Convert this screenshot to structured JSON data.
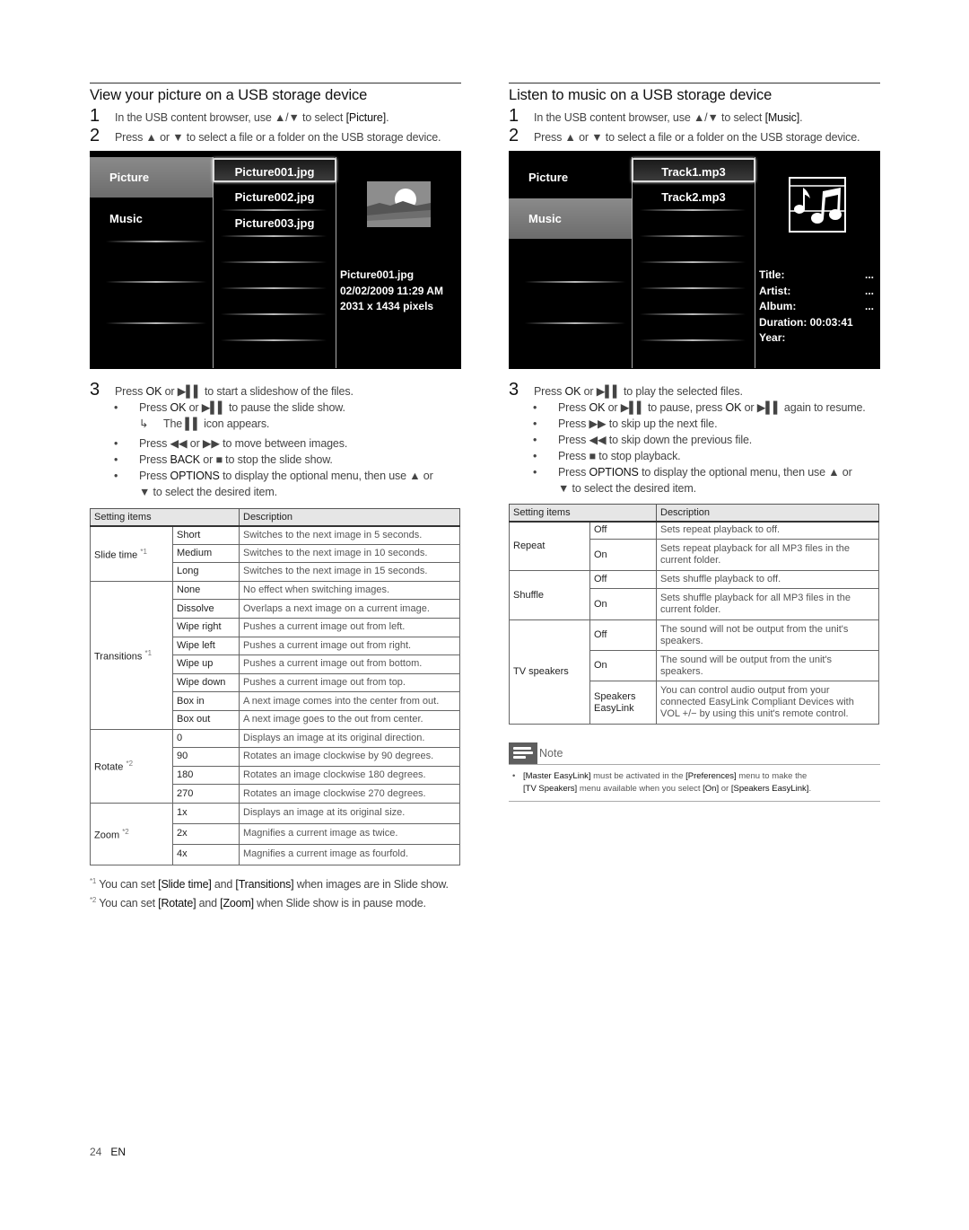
{
  "left": {
    "title": "View your picture on a USB storage device",
    "steps": [
      {
        "num": "1",
        "text_pre": "In the USB content browser, use ▲/▼ to select ",
        "bold": "[Picture]",
        "text_post": "."
      },
      {
        "num": "2",
        "text": "Press ▲ or ▼ to select a file or a folder on the USB storage device."
      }
    ],
    "screen": {
      "categories": [
        "Picture",
        "Music"
      ],
      "selected_category": "Picture",
      "files": [
        "Picture001.jpg",
        "Picture002.jpg",
        "Picture003.jpg"
      ],
      "selected_file": "Picture001.jpg",
      "info": [
        "Picture001.jpg",
        "02/02/2009 11:29 AM",
        "2031 x 1434 pixels"
      ]
    },
    "step3": {
      "num": "3",
      "pre": "Press ",
      "ok": "OK",
      "mid": " or ▶▌▌ to start a slideshow of the files."
    },
    "bullets": [
      {
        "pre": "Press ",
        "b": "OK",
        "post": " or ▶▌▌ to pause the slide show."
      },
      {
        "pre": "Press ◀◀ or ▶▶ to move between images.",
        "b": "",
        "post": ""
      },
      {
        "pre": "Press ",
        "b": "BACK",
        "post": " or ■ to stop the slide show."
      },
      {
        "pre": "Press ",
        "b": "OPTIONS",
        "post": " to display the optional menu, then use ▲ or"
      }
    ],
    "bullet_sub": "The ▌▌ icon appears.",
    "bullet_cont": "▼ to select the desired item.",
    "table": {
      "headers": [
        "Setting items",
        "Description"
      ],
      "groups": [
        {
          "item": "Slide time",
          "mark": "*1",
          "rows": [
            [
              "Short",
              "Switches to the next image in 5 seconds."
            ],
            [
              "Medium",
              "Switches to the next image in 10 seconds."
            ],
            [
              "Long",
              "Switches to the next image in 15 seconds."
            ]
          ]
        },
        {
          "item": "Transitions",
          "mark": "*1",
          "rows": [
            [
              "None",
              "No effect when switching images."
            ],
            [
              "Dissolve",
              "Overlaps a next image on a current image."
            ],
            [
              "Wipe right",
              "Pushes a current image out from left."
            ],
            [
              "Wipe left",
              "Pushes a current image out from right."
            ],
            [
              "Wipe up",
              "Pushes a current image out from bottom."
            ],
            [
              "Wipe down",
              "Pushes a current image out from top."
            ],
            [
              "Box in",
              "A next image comes into the center from out."
            ],
            [
              "Box out",
              "A next image goes to the out from center."
            ]
          ]
        },
        {
          "item": "Rotate",
          "mark": "*2",
          "rows": [
            [
              "0",
              "Displays an image at its original direction."
            ],
            [
              "90",
              "Rotates an image clockwise by 90 degrees."
            ],
            [
              "180",
              "Rotates an image clockwise 180 degrees."
            ],
            [
              "270",
              "Rotates an image clockwise 270 degrees."
            ]
          ]
        },
        {
          "item": "Zoom",
          "mark": "*2",
          "rows": [
            [
              "1x",
              "Displays an image at its original size."
            ],
            [
              "2x",
              "Magnifies a current image as twice."
            ],
            [
              "4x",
              "Magnifies a current image as fourfold."
            ]
          ]
        }
      ]
    },
    "footnotes": [
      {
        "mark": "*1",
        "pre": " You can set ",
        "b1": "[Slide time]",
        "mid": " and ",
        "b2": "[Transitions]",
        "post": " when images are in Slide show."
      },
      {
        "mark": "*2",
        "pre": " You can set ",
        "b1": "[Rotate]",
        "mid": " and ",
        "b2": "[Zoom]",
        "post": " when Slide show is in pause mode."
      }
    ]
  },
  "right": {
    "title": "Listen to music on a USB storage device",
    "steps": [
      {
        "num": "1",
        "text_pre": "In the USB content browser, use ▲/▼ to select ",
        "bold": "[Music]",
        "text_post": "."
      },
      {
        "num": "2",
        "text": "Press ▲ or ▼ to select a file or a folder on the USB storage device."
      }
    ],
    "screen": {
      "categories": [
        "Picture",
        "Music"
      ],
      "selected_category": "Music",
      "files": [
        "Track1.mp3",
        "Track2.mp3"
      ],
      "selected_file": "Track1.mp3",
      "tags": [
        {
          "label": "Title:",
          "value": "..."
        },
        {
          "label": "Artist:",
          "value": "..."
        },
        {
          "label": "Album:",
          "value": "..."
        },
        {
          "label": "Duration: 00:03:41",
          "value": ""
        },
        {
          "label": "Year:",
          "value": ""
        }
      ]
    },
    "step3": {
      "num": "3",
      "pre": "Press ",
      "ok": "OK",
      "mid": " or ▶▌▌ to play the selected files."
    },
    "bullets": [
      {
        "pre": "Press ",
        "b": "OK",
        "mid": " or ▶▌▌ to pause, press ",
        "b2": "OK",
        "post": " or ▶▌▌ again to resume."
      },
      {
        "pre": "Press ▶▶ to skip up the next file."
      },
      {
        "pre": "Press ◀◀ to skip down the previous file."
      },
      {
        "pre": "Press ■ to stop playback."
      },
      {
        "pre": "Press ",
        "b": "OPTIONS",
        "post": " to display the optional menu, then use ▲ or"
      }
    ],
    "bullet_cont": "▼ to select the desired item.",
    "table": {
      "headers": [
        "Setting items",
        "Description"
      ],
      "groups": [
        {
          "item": "Repeat",
          "rows": [
            [
              "Off",
              "Sets repeat playback to off."
            ],
            [
              "On",
              "Sets repeat playback for all MP3 files in the current folder."
            ]
          ]
        },
        {
          "item": "Shuffle",
          "rows": [
            [
              "Off",
              "Sets shuffle playback to off."
            ],
            [
              "On",
              "Sets shuffle playback for all MP3 files in the current folder."
            ]
          ]
        },
        {
          "item": "TV speakers",
          "rows": [
            [
              "Off",
              "The sound will not be output from the unit's speakers."
            ],
            [
              "On",
              "The sound will be output from the unit's speakers."
            ],
            [
              "Speakers EasyLink",
              "You can control audio output from your connected EasyLink Compliant Devices with VOL +/− by using this unit's remote control."
            ]
          ]
        }
      ]
    },
    "note": {
      "label": "Note",
      "b1": "[Master EasyLink]",
      "t1": " must be activated in the ",
      "b2": "[Preferences]",
      "t2": " menu to make the ",
      "b3": "[TV Speakers]",
      "t3": " menu available when you select ",
      "b4": "[On]",
      "t4": " or ",
      "b5": "[Speakers EasyLink]",
      "t5": "."
    }
  },
  "footer": {
    "page": "24",
    "lang": "EN"
  }
}
